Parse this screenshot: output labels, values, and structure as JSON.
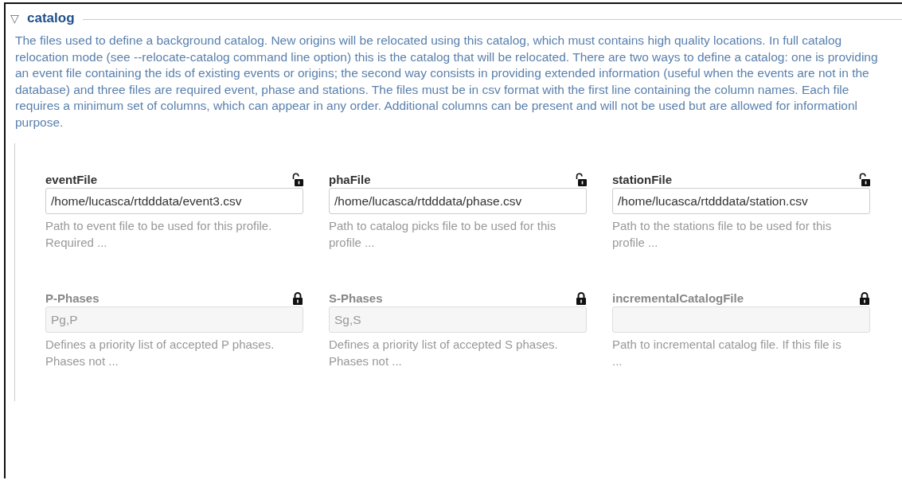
{
  "section": {
    "toggle": "▽",
    "title": "catalog",
    "description": "The files used to define a background catalog. New origins will be relocated using this catalog, which must contains high quality locations. In full catalog relocation mode (see --relocate-catalog command line option) this is the catalog that will be relocated. There are two ways to define a catalog: one is providing an event file containing the ids of existing events or origins; the second way consists in providing extended information (useful when the events are not in the database) and three files are required event, phase and stations. The files must be in csv format with the first line containing the column names. Each file requires a minimum set of columns, which can appear in any order. Additional columns can be present and will not be used but are allowed for informationl purpose."
  },
  "fields": [
    {
      "label": "eventFile",
      "locked": false,
      "value": "/home/lucasca/rtdddata/event3.csv",
      "hint": "Path to event file to be used for this profile. Required ..."
    },
    {
      "label": "phaFile",
      "locked": false,
      "value": "/home/lucasca/rtdddata/phase.csv",
      "hint": "Path to catalog picks file to be used for this profile ..."
    },
    {
      "label": "stationFile",
      "locked": false,
      "value": "/home/lucasca/rtdddata/station.csv",
      "hint": "Path to the stations file to be used for this profile ..."
    },
    {
      "label": "P-Phases",
      "locked": true,
      "placeholder": "Pg,P",
      "hint": "Defines a priority list of accepted P phases. Phases not ..."
    },
    {
      "label": "S-Phases",
      "locked": true,
      "placeholder": "Sg,S",
      "hint": "Defines a priority list of accepted S phases. Phases not ..."
    },
    {
      "label": "incrementalCatalogFile",
      "locked": true,
      "hint": "Path to incremental catalog file. If this file is ..."
    }
  ]
}
